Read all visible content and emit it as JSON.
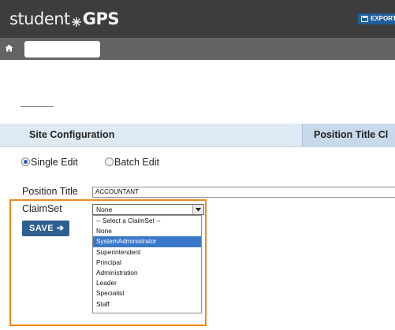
{
  "app": {
    "logo_prefix": "student",
    "logo_suffix": "GPS"
  },
  "toolbar": {
    "export_label": "EXPORT"
  },
  "tabs": [
    {
      "label": "Site Configuration"
    },
    {
      "label": "Position Title Cl"
    }
  ],
  "edit_mode": {
    "options": [
      {
        "label": "Single Edit",
        "selected": true
      },
      {
        "label": "Batch Edit",
        "selected": false
      }
    ]
  },
  "form": {
    "position_title_label": "Position Title",
    "position_title_value": "ACCOUNTANT",
    "claimset_label": "ClaimSet",
    "claimset_value": "None",
    "claimset_options": [
      "-- Select a ClaimSet --",
      "None",
      "SystemAdministrator",
      "Superintendent",
      "Principal",
      "Administration",
      "Leader",
      "Specialist",
      "Staff"
    ],
    "claimset_highlighted_index": 2,
    "save_label": "SAVE"
  },
  "icons": {
    "home": "home-icon",
    "export": "floppy-disk-icon",
    "save_arrow": "arrow-right-icon"
  },
  "colors": {
    "topbar": "#3d3d3d",
    "navbar": "#636363",
    "accent": "#2f5f91",
    "highlight": "#f0891e",
    "tab_bg": "#dfe9f4"
  }
}
